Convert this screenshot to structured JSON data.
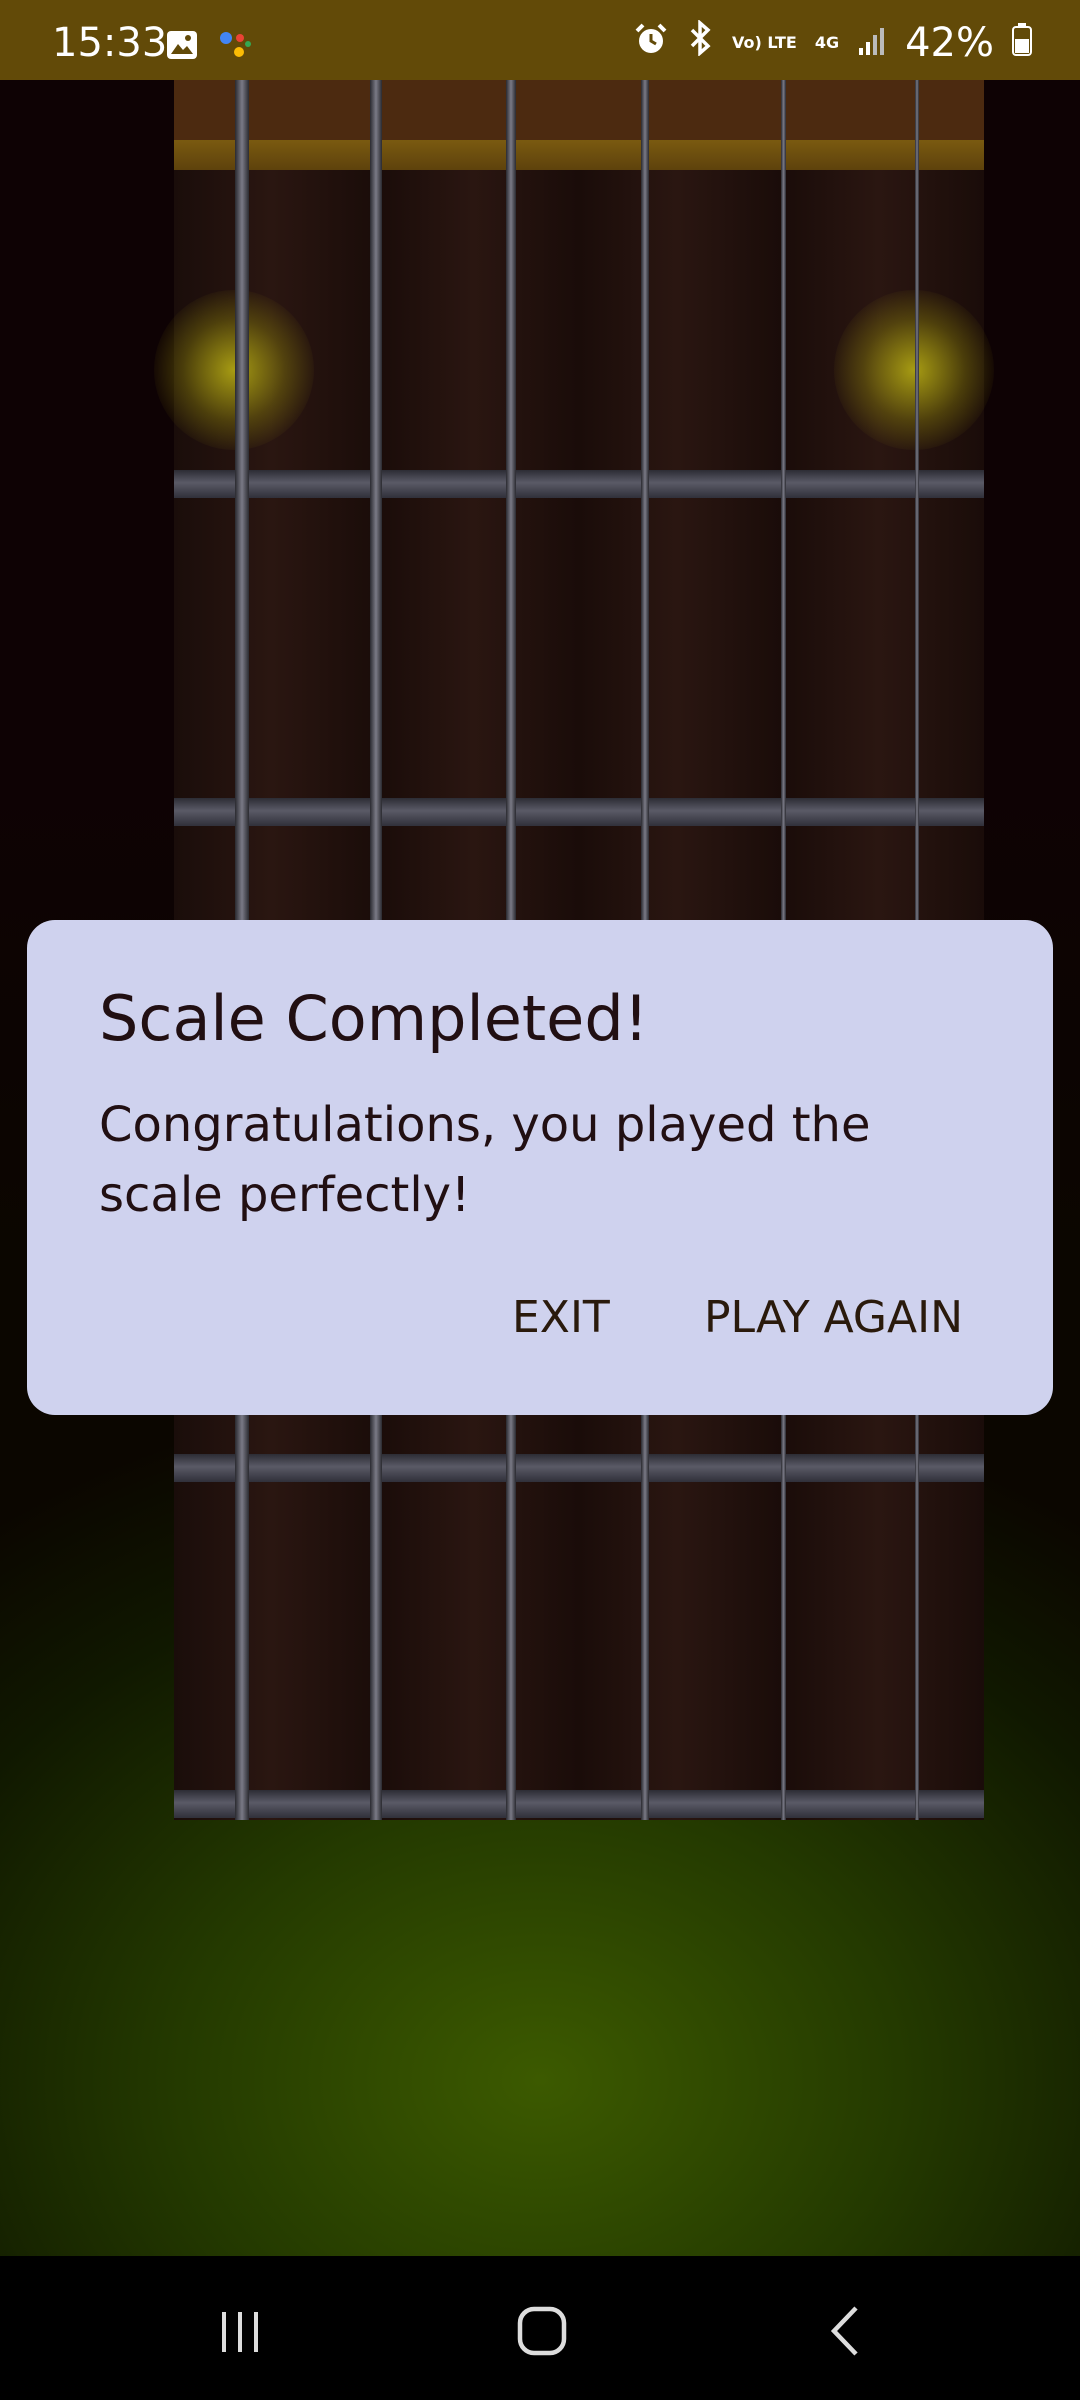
{
  "status_bar": {
    "time": "15:33",
    "battery_percent": "42%",
    "lte_label": "Vo) LTE",
    "net_label": "4G",
    "icons": [
      "gallery-icon",
      "assistant-icon",
      "alarm-icon",
      "bluetooth-icon",
      "volte-icon",
      "4g-icon",
      "signal-icon",
      "battery-icon"
    ],
    "bg_color": "#624a08"
  },
  "fretboard": {
    "strings": 6,
    "highlighted_notes": [
      "string-1-fret-1",
      "string-6-fret-1"
    ],
    "highlight_color": "#bdb414"
  },
  "dialog": {
    "title": "Scale Completed!",
    "message": "Congratulations, you played the scale perfectly!",
    "exit_label": "EXIT",
    "play_again_label": "PLAY AGAIN",
    "bg_color": "#cfd2ee"
  },
  "nav_bar": {
    "icons": [
      "recent-apps-icon",
      "home-icon",
      "back-icon"
    ]
  }
}
